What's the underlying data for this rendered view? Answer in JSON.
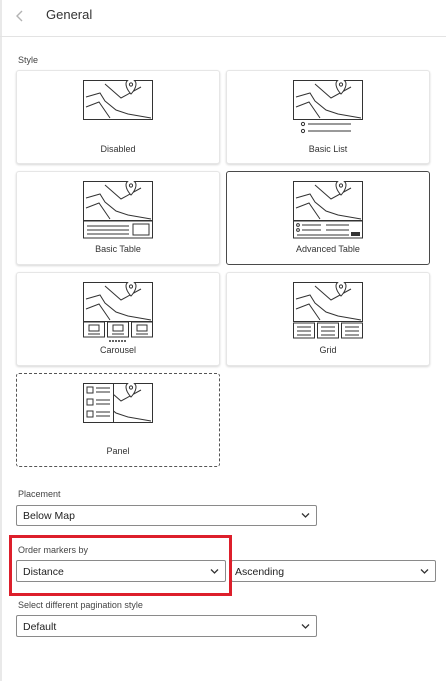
{
  "header": {
    "title": "General",
    "back_icon": "chevron-left-icon"
  },
  "style_section": {
    "label": "Style",
    "options": [
      {
        "label": "Disabled",
        "selected": false
      },
      {
        "label": "Basic List",
        "selected": false
      },
      {
        "label": "Basic Table",
        "selected": false
      },
      {
        "label": "Advanced Table",
        "selected": true
      },
      {
        "label": "Carousel",
        "selected": false
      },
      {
        "label": "Grid",
        "selected": false
      },
      {
        "label": "Panel",
        "selected": false
      }
    ]
  },
  "placement": {
    "label": "Placement",
    "value": "Below Map"
  },
  "order_markers": {
    "label": "Order markers by",
    "field_value": "Distance",
    "direction_value": "Ascending"
  },
  "pagination": {
    "label": "Select different pagination style",
    "value": "Default"
  },
  "colors": {
    "highlight": "#dd1f2b",
    "selected_border": "#4a4a4a"
  }
}
